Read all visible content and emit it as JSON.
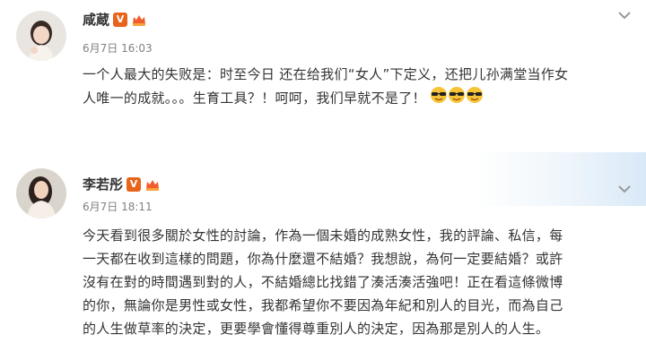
{
  "posts": [
    {
      "author": "咸蔵",
      "verified_badge": "V",
      "time": "6月7日 16:03",
      "text_line1": "一个人最大的失败是：时至今日 还在给我们“女人”下定义，还把儿孙满堂当作女",
      "text_line2": "人唯一的成就。。。生育工具？！呵呵，我们早就不是了！",
      "emoji_icons": [
        "cool-face-icon",
        "cool-face-icon",
        "cool-face-icon"
      ]
    },
    {
      "author": "李若彤",
      "verified_badge": "V",
      "time": "6月7日 18:11",
      "lines": [
        "今天看到很多關於女性的討論，作為一個未婚的成熟女性，我的評論、私信，每",
        "一天都在收到這樣的問題，你為什麼還不結婚？我想說，為何一定要結婚？或許",
        "沒有在對的時間遇到對的人，不結婚總比找錯了湊活湊活強吧！正在看這條微博",
        "的你，無論你是男性或女性，我都希望你不要因為年紀和別人的目光，而為自己",
        "的人生做草率的決定，更要學會懂得尊重別人的決定，因為那是別人的人生。"
      ]
    }
  ],
  "colors": {
    "text": "#333333",
    "time": "#808080",
    "verified": "#e8631b",
    "emoji": "#f7c437"
  }
}
